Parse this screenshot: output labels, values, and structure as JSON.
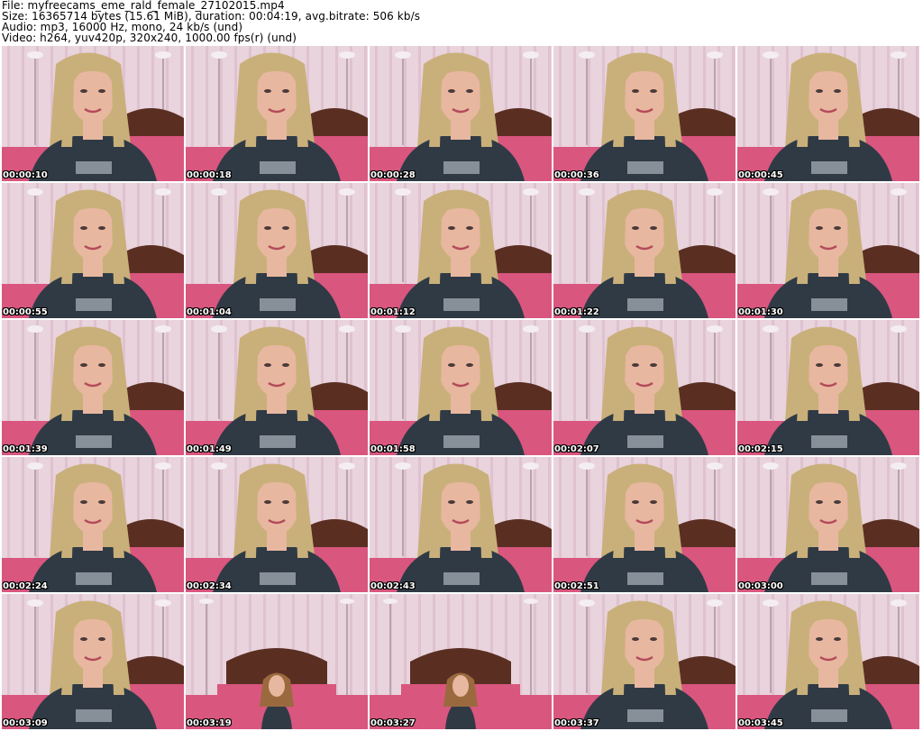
{
  "header": {
    "file_line": "File: myfreecams_eme_rald_female_27102015.mp4",
    "size_line": "Size: 16365714 bytes (15.61 MiB), duration: 00:04:19, avg.bitrate: 506 kb/s",
    "audio_line": "Audio: mp3, 16000 Hz, mono, 24 kb/s (und)",
    "video_line": "Video: h264, yuv420p, 320x240, 1000.00 fps(r) (und)"
  },
  "colors": {
    "wallpaper": "#e9d3dc",
    "wallpaper_stripe": "#d8b8c8",
    "bed_pink": "#d9567e",
    "headboard": "#5a2f22",
    "hair": "#c9b07a",
    "skin": "#e8b7a0",
    "shirt": "#2f3a45",
    "timestamp": "#ffffff"
  },
  "thumbnails": [
    {
      "time": "00:00:10",
      "view": "close"
    },
    {
      "time": "00:00:18",
      "view": "close"
    },
    {
      "time": "00:00:28",
      "view": "close"
    },
    {
      "time": "00:00:36",
      "view": "close"
    },
    {
      "time": "00:00:45",
      "view": "close"
    },
    {
      "time": "00:00:55",
      "view": "close"
    },
    {
      "time": "00:01:04",
      "view": "close"
    },
    {
      "time": "00:01:12",
      "view": "close"
    },
    {
      "time": "00:01:22",
      "view": "close"
    },
    {
      "time": "00:01:30",
      "view": "close"
    },
    {
      "time": "00:01:39",
      "view": "close"
    },
    {
      "time": "00:01:49",
      "view": "close"
    },
    {
      "time": "00:01:58",
      "view": "close"
    },
    {
      "time": "00:02:07",
      "view": "close"
    },
    {
      "time": "00:02:15",
      "view": "close"
    },
    {
      "time": "00:02:24",
      "view": "close"
    },
    {
      "time": "00:02:34",
      "view": "close"
    },
    {
      "time": "00:02:43",
      "view": "close"
    },
    {
      "time": "00:02:51",
      "view": "close"
    },
    {
      "time": "00:03:00",
      "view": "close"
    },
    {
      "time": "00:03:09",
      "view": "close"
    },
    {
      "time": "00:03:19",
      "view": "wide"
    },
    {
      "time": "00:03:27",
      "view": "wide"
    },
    {
      "time": "00:03:37",
      "view": "close"
    },
    {
      "time": "00:03:45",
      "view": "close"
    }
  ]
}
